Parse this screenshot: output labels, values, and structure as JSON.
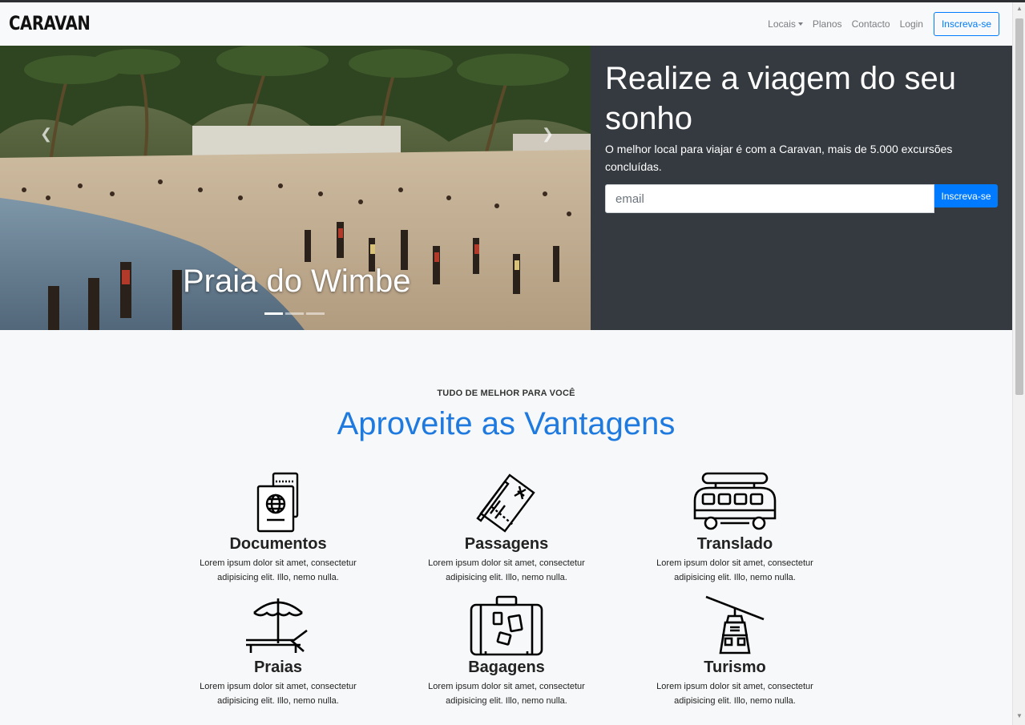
{
  "brand": "CARAVAN",
  "nav": {
    "locais": "Locais",
    "planos": "Planos",
    "contacto": "Contacto",
    "login": "Login",
    "cta": "Inscreva-se"
  },
  "carousel": {
    "caption": "Praia do Wimbe",
    "prev_icon": "chevron-left-icon",
    "next_icon": "chevron-right-icon",
    "slide_count": 3,
    "active_slide": 1
  },
  "hero": {
    "title": "Realize a viagem do seu sonho",
    "subtitle": "O melhor local para viajar é com a Caravan, mais de 5.000 excursões concluídas.",
    "email_placeholder": "email",
    "button": "Inscreva-se"
  },
  "features": {
    "eyebrow": "TUDO DE MELHOR PARA VOCÊ",
    "title": "Aproveite as Vantagens",
    "items": [
      {
        "title": "Documentos",
        "text": "Lorem ipsum dolor sit amet, consectetur adipisicing elit. Illo, nemo nulla.",
        "icon": "passport-icon"
      },
      {
        "title": "Passagens",
        "text": "Lorem ipsum dolor sit amet, consectetur adipisicing elit. Illo, nemo nulla.",
        "icon": "ticket-icon"
      },
      {
        "title": "Translado",
        "text": "Lorem ipsum dolor sit amet, consectetur adipisicing elit. Illo, nemo nulla.",
        "icon": "van-icon"
      },
      {
        "title": "Praias",
        "text": "Lorem ipsum dolor sit amet, consectetur adipisicing elit. Illo, nemo nulla.",
        "icon": "beach-chair-icon"
      },
      {
        "title": "Bagagens",
        "text": "Lorem ipsum dolor sit amet, consectetur adipisicing elit. Illo, nemo nulla.",
        "icon": "suitcase-icon"
      },
      {
        "title": "Turismo",
        "text": "Lorem ipsum dolor sit amet, consectetur adipisicing elit. Illo, nemo nulla.",
        "icon": "cable-car-icon"
      }
    ]
  },
  "colors": {
    "primary": "#007bff",
    "title_blue": "#1f7ae0",
    "panel_dark": "#343a40"
  }
}
